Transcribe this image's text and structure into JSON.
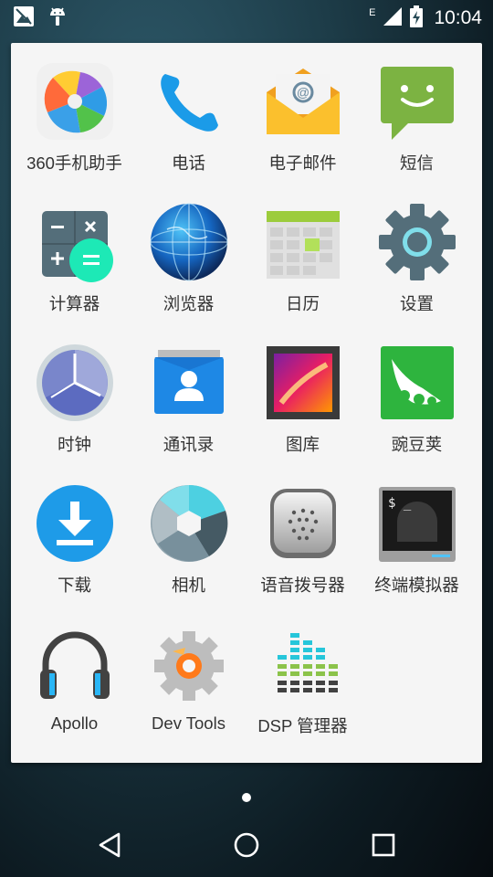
{
  "status_bar": {
    "left_icons": [
      "screenshot-icon",
      "android-debug-icon"
    ],
    "network_type": "E",
    "time": "10:04"
  },
  "app_drawer": {
    "apps": [
      {
        "label": "360手机助手",
        "icon": "360-assistant-icon"
      },
      {
        "label": "电话",
        "icon": "phone-icon"
      },
      {
        "label": "电子邮件",
        "icon": "email-icon"
      },
      {
        "label": "短信",
        "icon": "sms-icon"
      },
      {
        "label": "计算器",
        "icon": "calculator-icon"
      },
      {
        "label": "浏览器",
        "icon": "browser-icon"
      },
      {
        "label": "日历",
        "icon": "calendar-icon"
      },
      {
        "label": "设置",
        "icon": "settings-icon"
      },
      {
        "label": "时钟",
        "icon": "clock-icon"
      },
      {
        "label": "通讯录",
        "icon": "contacts-icon"
      },
      {
        "label": "图库",
        "icon": "gallery-icon"
      },
      {
        "label": "豌豆荚",
        "icon": "wandoujia-icon"
      },
      {
        "label": "下载",
        "icon": "download-icon"
      },
      {
        "label": "相机",
        "icon": "camera-icon"
      },
      {
        "label": "语音拨号器",
        "icon": "voice-dialer-icon"
      },
      {
        "label": "终端模拟器",
        "icon": "terminal-icon"
      },
      {
        "label": "Apollo",
        "icon": "apollo-headphones-icon"
      },
      {
        "label": "Dev Tools",
        "icon": "dev-tools-icon"
      },
      {
        "label": "DSP 管理器",
        "icon": "dsp-manager-icon"
      }
    ]
  },
  "pager": {
    "pages": 1,
    "current": 1
  },
  "nav_bar": [
    "back-icon",
    "home-icon",
    "recents-icon"
  ]
}
